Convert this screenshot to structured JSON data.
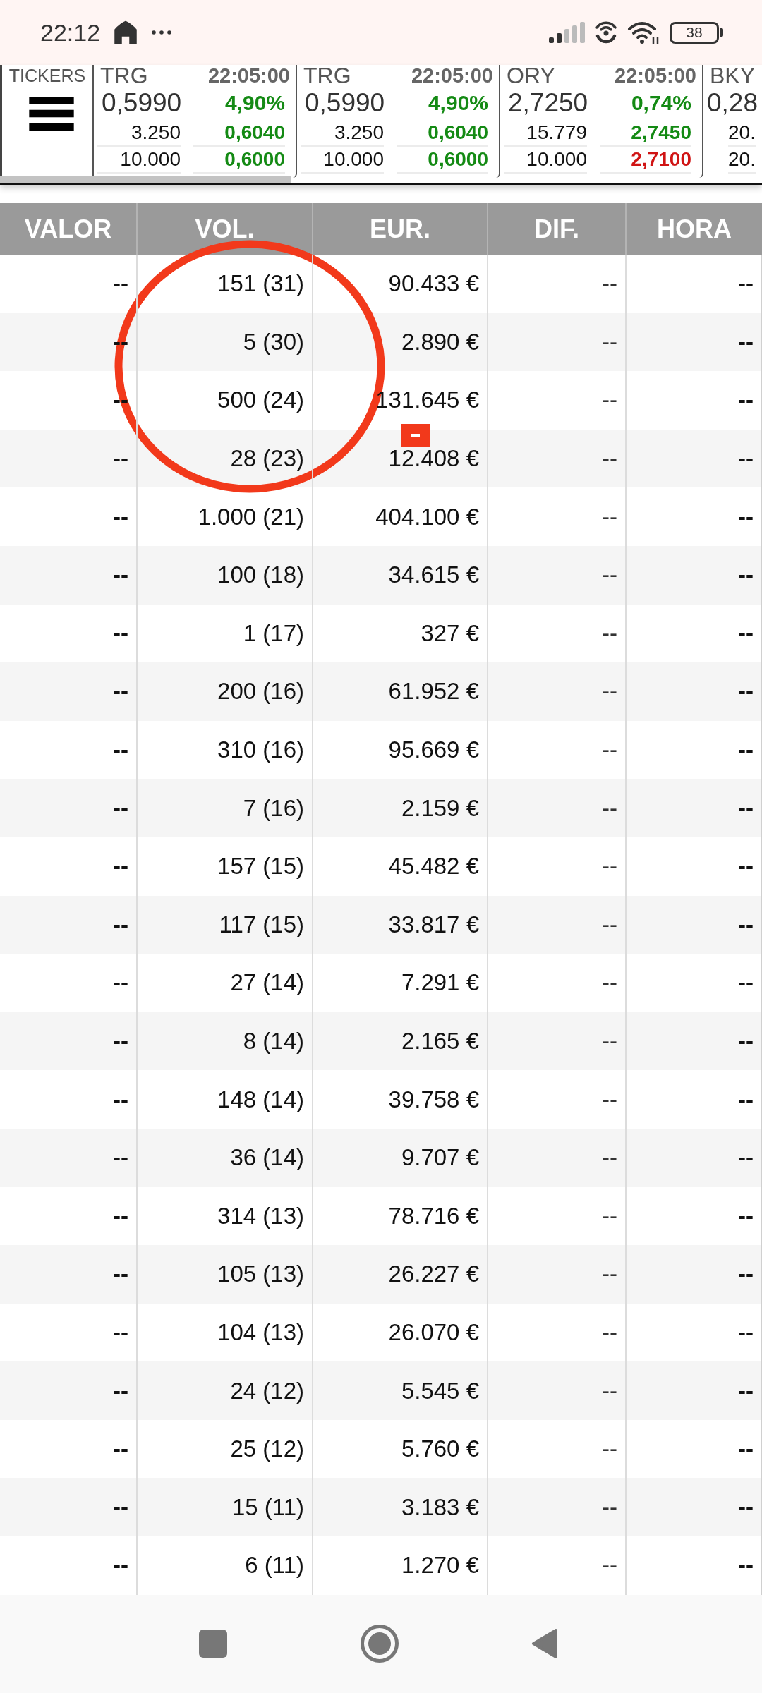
{
  "status_bar": {
    "time": "22:12",
    "battery": "38"
  },
  "ticker_strip": {
    "label": "TICKERS",
    "tickers": [
      {
        "symbol": "TRG",
        "time": "22:05:00",
        "price": "0,5990",
        "change": "4,90%",
        "change_negative": false,
        "orders": [
          {
            "quantity": "3.250",
            "price": "0,6040",
            "negative": false
          },
          {
            "quantity": "10.000",
            "price": "0,6000",
            "negative": false
          }
        ]
      },
      {
        "symbol": "TRG",
        "time": "22:05:00",
        "price": "0,5990",
        "change": "4,90%",
        "change_negative": false,
        "orders": [
          {
            "quantity": "3.250",
            "price": "0,6040",
            "negative": false
          },
          {
            "quantity": "10.000",
            "price": "0,6000",
            "negative": false
          }
        ]
      },
      {
        "symbol": "ORY",
        "time": "22:05:00",
        "price": "2,7250",
        "change": "0,74%",
        "change_negative": false,
        "orders": [
          {
            "quantity": "15.779",
            "price": "2,7450",
            "negative": false
          },
          {
            "quantity": "10.000",
            "price": "2,7100",
            "negative": true
          }
        ]
      },
      {
        "symbol": "BKY",
        "price": "0,28",
        "orders": [
          {
            "quantity": "20."
          },
          {
            "quantity": "20."
          }
        ]
      }
    ]
  },
  "table": {
    "columns": [
      "VALOR",
      "VOL.",
      "EUR.",
      "DIF.",
      "HORA"
    ],
    "rows": [
      [
        "--",
        "151 (31)",
        "90.433 €",
        "--",
        "--"
      ],
      [
        "--",
        "5 (30)",
        "2.890 €",
        "--",
        "--"
      ],
      [
        "--",
        "500 (24)",
        "131.645 €",
        "--",
        "--"
      ],
      [
        "--",
        "28 (23)",
        "12.408 €",
        "--",
        "--"
      ],
      [
        "--",
        "1.000 (21)",
        "404.100 €",
        "--",
        "--"
      ],
      [
        "--",
        "100 (18)",
        "34.615 €",
        "--",
        "--"
      ],
      [
        "--",
        "1 (17)",
        "327 €",
        "--",
        "--"
      ],
      [
        "--",
        "200 (16)",
        "61.952 €",
        "--",
        "--"
      ],
      [
        "--",
        "310 (16)",
        "95.669 €",
        "--",
        "--"
      ],
      [
        "--",
        "7 (16)",
        "2.159 €",
        "--",
        "--"
      ],
      [
        "--",
        "157 (15)",
        "45.482 €",
        "--",
        "--"
      ],
      [
        "--",
        "117 (15)",
        "33.817 €",
        "--",
        "--"
      ],
      [
        "--",
        "27 (14)",
        "7.291 €",
        "--",
        "--"
      ],
      [
        "--",
        "8 (14)",
        "2.165 €",
        "--",
        "--"
      ],
      [
        "--",
        "148 (14)",
        "39.758 €",
        "--",
        "--"
      ],
      [
        "--",
        "36 (14)",
        "9.707 €",
        "--",
        "--"
      ],
      [
        "--",
        "314 (13)",
        "78.716 €",
        "--",
        "--"
      ],
      [
        "--",
        "105 (13)",
        "26.227 €",
        "--",
        "--"
      ],
      [
        "--",
        "104 (13)",
        "26.070 €",
        "--",
        "--"
      ],
      [
        "--",
        "24 (12)",
        "5.545 €",
        "--",
        "--"
      ],
      [
        "--",
        "25 (12)",
        "5.760 €",
        "--",
        "--"
      ],
      [
        "--",
        "15 (11)",
        "3.183 €",
        "--",
        "--"
      ],
      [
        "--",
        "6 (11)",
        "1.270 €",
        "--",
        "--"
      ]
    ]
  },
  "annotations": {
    "circle": true,
    "marker": true
  }
}
